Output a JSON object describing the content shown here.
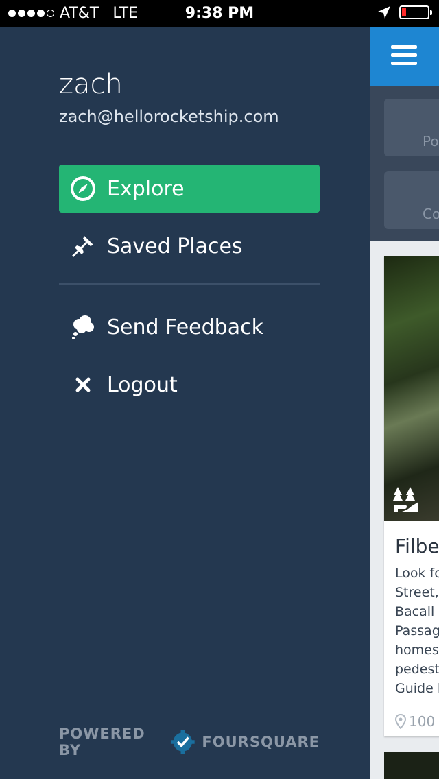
{
  "status_bar": {
    "carrier": "AT&T",
    "network": "LTE",
    "time": "9:38 PM",
    "signal_bars": 4,
    "battery_level": 0.12
  },
  "drawer": {
    "user": {
      "name": "zach",
      "email": "zach@hellorocketship.com"
    },
    "menu": [
      {
        "label": "Explore",
        "icon": "compass-icon",
        "active": true
      },
      {
        "label": "Saved Places",
        "icon": "pin-icon",
        "active": false
      },
      {
        "label": "Send Feedback",
        "icon": "thought-bubble-icon",
        "active": false
      },
      {
        "label": "Logout",
        "icon": "close-icon",
        "active": false
      }
    ],
    "powered_by": {
      "prefix": "POWERED BY",
      "brand": "FOURSQUARE"
    }
  },
  "main": {
    "filters": [
      {
        "label": "Po"
      },
      {
        "label": "Co"
      }
    ],
    "card": {
      "title": "Filber",
      "description": "Look fo\nStreet,\nBacall i\nPassag\nhomes\npedest\nGuide l",
      "distance": "100"
    }
  },
  "colors": {
    "accent": "#24b574",
    "drawer_bg": "#243850",
    "topbar": "#1e86d2"
  }
}
